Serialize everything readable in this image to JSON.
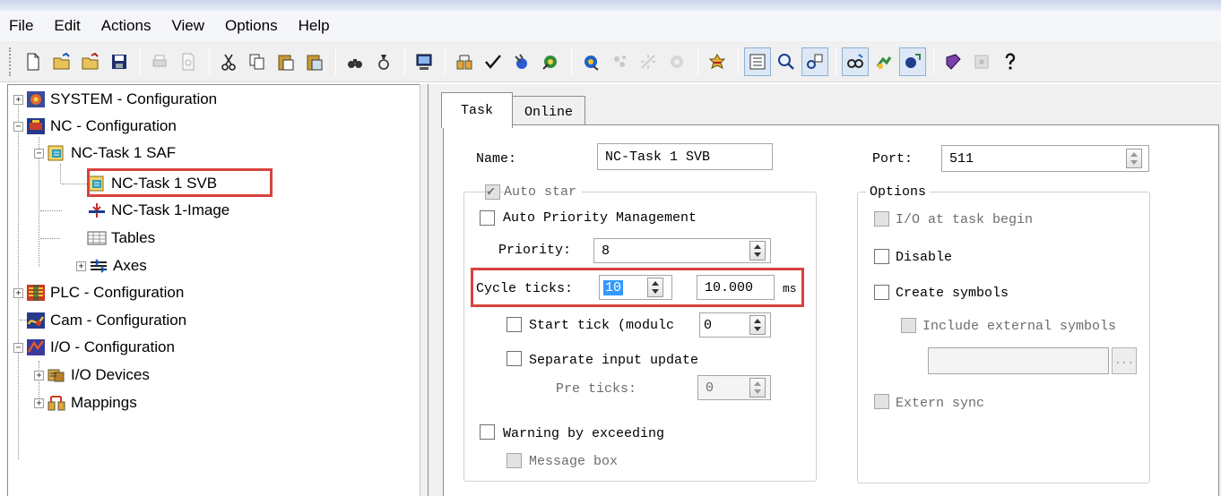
{
  "menu": [
    "File",
    "Edit",
    "Actions",
    "View",
    "Options",
    "Help"
  ],
  "toolbar_icons": [
    "new-file",
    "open-folder",
    "open-folder-2",
    "save",
    "print",
    "print-preview",
    "cut",
    "copy",
    "paste",
    "paste-special",
    "find",
    "find-next",
    "activate-config",
    "generate-mappings",
    "check-config",
    "build",
    "target-system",
    "run-mode",
    "config-mode",
    "reload-devices",
    "scan-devices",
    "set-config",
    "show-tree",
    "zoom",
    "search-devices",
    "online",
    "watch",
    "help-topics",
    "settings",
    "about"
  ],
  "tree": {
    "items": [
      {
        "label": "SYSTEM - Configuration"
      },
      {
        "label": "NC - Configuration"
      },
      {
        "label": "NC-Task 1 SAF"
      },
      {
        "label": "NC-Task 1 SVB"
      },
      {
        "label": "NC-Task 1-Image"
      },
      {
        "label": "Tables"
      },
      {
        "label": "Axes"
      },
      {
        "label": "PLC - Configuration"
      },
      {
        "label": "Cam - Configuration"
      },
      {
        "label": "I/O - Configuration"
      },
      {
        "label": "I/O Devices"
      },
      {
        "label": "Mappings"
      }
    ]
  },
  "tabs": {
    "task": "Task",
    "online": "Online"
  },
  "form": {
    "name_label": "Name:",
    "name_value": "NC-Task 1 SVB",
    "auto_start": "Auto star",
    "auto_priority": "Auto Priority Management",
    "priority_label": "Priority:",
    "priority_value": "8",
    "cycle_ticks_label": "Cycle ticks:",
    "cycle_ticks_value": "10",
    "cycle_time_value": "10.000",
    "cycle_unit": "ms",
    "start_tick_label": "Start tick (modulc",
    "start_tick_value": "0",
    "separate_input": "Separate input update",
    "pre_ticks_label": "Pre ticks:",
    "pre_ticks_value": "0",
    "warning_exceeding": "Warning by exceeding",
    "message_box": "Message box",
    "port_label": "Port:",
    "port_value": "511",
    "options_title": "Options",
    "io_at_task_begin": "I/O at task begin",
    "disable": "Disable",
    "create_symbols": "Create symbols",
    "include_external": "Include external symbols",
    "external_field_value": "",
    "browse_label": "...",
    "extern_sync": "Extern sync"
  },
  "colors": {
    "highlight_box": "#d9413f",
    "selection": "#3399ff"
  }
}
